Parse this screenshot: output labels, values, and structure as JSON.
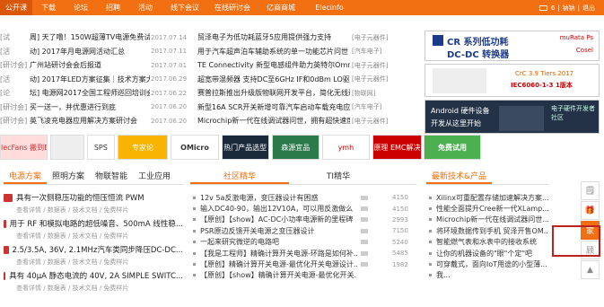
{
  "nav": {
    "items": [
      "公开课",
      "下载",
      "论坛",
      "招聘",
      "活动",
      "线下会议",
      "在线研讨会",
      "亿商商城",
      "Elecinfo"
    ],
    "active": 0
  },
  "user": {
    "count": "6",
    "name": "钠钠",
    "logout": "退出"
  },
  "news": [
    {
      "tag": "[试",
      "title": "周] 天了噜！150W超薄TV电源免费试用",
      "date": "2017.07.14",
      "title2": "贸泽电子为低功耗蓝牙5应用提供强力支持",
      "cat": "[电子元器件]"
    },
    {
      "tag": "[活",
      "title": "动] 2017年月电源网活动汇总",
      "date": "2017.07.11",
      "title2": "用于汽车超声泊车辅助系统的单一功能芯片问世",
      "cat": "[汽车电子]"
    },
    {
      "tag": "[研讨会]",
      "title": "广州站研讨会会后报道",
      "date": "2017.07.01",
      "title2": "TE Connectivity 新型电感组件助力英特尔Omni-Path架构",
      "cat": "[电子元器件]"
    },
    {
      "tag": "[活",
      "title": "动] 2017年LED方案征集｜技术方案大...",
      "date": "2017.06.29",
      "title2": "超宽带混频器 支持DC至6GHz IF和0dBm LO驱动功率",
      "cat": "[电子元器件]"
    },
    {
      "tag": "[论",
      "title": "坛] 电源网2017全国工程师巡回培训会会...",
      "date": "2017.06.22",
      "title2": "赛普拉斯推出升级版物联网开发平台，简化无线连接设计",
      "cat": "[物联网]"
    },
    {
      "tag": "[研讨会]",
      "title": "买一送一，并优惠进行到底",
      "date": "2017.06.20",
      "title2": "新型16A SCR开关新增可靠汽车启动车载充电应用进行了优化",
      "cat": "[汽车电子]"
    },
    {
      "tag": "[研讨会]",
      "title": "英飞凌充电器应用解决方案研讨会",
      "date": "2017.06.20",
      "title2": "Microchip新一代在线调试器问世，拥有超快速度和灵活性",
      "cat": "[电子元器件]"
    }
  ],
  "ads": {
    "ad1_title": "CR 系列低功耗",
    "ad1_sub": "DC-DC 转换器",
    "ad1_brands": [
      "muRata Ps",
      "Cosel"
    ],
    "ad2_text": "CrC 3.9 Tiers 2017",
    "ad2_sub": "IEC6060-1-3 1版本",
    "ad3_line1": "Android 硬件设备",
    "ad3_line2": "开发从这里开始",
    "ad3_side": "电子硬件开发者社区"
  },
  "banners": [
    "電源寶 ElecFans 搬到ElecFans",
    "",
    "SPS",
    "专家论",
    "OMicro",
    "热门产品选型",
    "森源宜品",
    "ymh",
    "电路原理 EMC解决方案",
    "免费试用"
  ],
  "tabs_left": [
    "电源方案",
    "照明方案",
    "物联智能",
    "工业应用"
  ],
  "tabs_mid": [
    "社区精华",
    "TI精华"
  ],
  "tab_right": "最新技术&产品",
  "solutions": [
    {
      "title": "具有一次侧稳压功能的恒压恒流 PWM",
      "sub": "查看详情 / 数据表 / 技术文档 / 免费样片"
    },
    {
      "title": "用于 RF 和模拟电路的超低噪音、500mA 线性稳...",
      "sub": "查看详情 / 数据表 / 技术文档 / 免费样片"
    },
    {
      "title": "2.5/3.5A, 36V, 2.1MHz汽车类同步降压DC-DC...",
      "sub": "查看详情 / 数据表 / 技术文档 / 免费样片"
    },
    {
      "title": "具有 40μA 静态电流的 40V, 2A SIMPLE SWITC...",
      "sub": "查看详情 / 数据表 / 技术文档 / 免费样片"
    }
  ],
  "community": [
    {
      "title": "12v 5a反激电源，变压器设计有困惑",
      "count": "4150"
    },
    {
      "title": "输入DC40-90，输出12V10A，可以用反激做么",
      "count": "4150"
    },
    {
      "title": "【原创】【show】AC-DC小功率电源新的里程碑",
      "count": "2993"
    },
    {
      "title": "PSR原边反馈开关电源之变压器设计",
      "count": "7150"
    },
    {
      "title": "一起来研究微逆的电路吧",
      "count": "5240"
    },
    {
      "title": "【我是工程师】精确计算开关电源-环路是如何补...",
      "count": "5485"
    },
    {
      "title": "【原创】精确计算开关电源-最优化开关电源设计...",
      "count": "1982"
    },
    {
      "title": "【原创】【show】精确计算开关电源-最优化开关...",
      "count": ""
    }
  ],
  "latest": [
    "Xilinx可重配置存储加速解决方案...",
    "性能全面提升Cree新一代XLamp...",
    "Microchip新一代在线调试器问世...",
    "将环境数据传到手机 贸泽开售OM...",
    "智能燃气表和水表中的接收系统",
    "让你的机器设备的\"眼\"个定\"吧",
    "可穿戴式，面向IoT用途的小型薄...",
    "我..."
  ],
  "sidebar": [
    "🗒",
    "🎁",
    "家",
    "顾",
    "▲"
  ]
}
